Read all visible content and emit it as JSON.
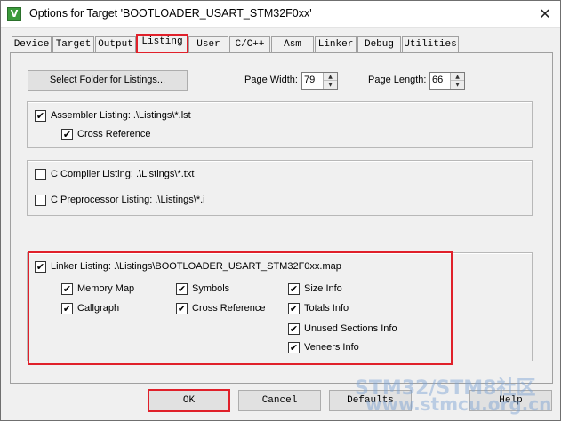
{
  "window": {
    "title": "Options for Target 'BOOTLOADER_USART_STM32F0xx'",
    "close_glyph": "✕",
    "app_icon_letter": "V"
  },
  "tabs": [
    {
      "label": "Device"
    },
    {
      "label": "Target"
    },
    {
      "label": "Output"
    },
    {
      "label": "Listing",
      "active": true
    },
    {
      "label": "User"
    },
    {
      "label": "C/C++"
    },
    {
      "label": "Asm"
    },
    {
      "label": "Linker"
    },
    {
      "label": "Debug"
    },
    {
      "label": "Utilities"
    }
  ],
  "top_row": {
    "select_folder_label": "Select Folder for Listings...",
    "page_width_label": "Page Width:",
    "page_width_value": "79",
    "page_length_label": "Page Length:",
    "page_length_value": "66"
  },
  "assembler": {
    "listing_label": "Assembler Listing:  .\\Listings\\*.lst",
    "listing_checked": true,
    "cross_ref_label": "Cross Reference",
    "cross_ref_checked": true
  },
  "compiler": {
    "c_compiler_label": "C Compiler Listing:  .\\Listings\\*.txt",
    "c_compiler_checked": false,
    "c_preprocessor_label": "C Preprocessor Listing:  .\\Listings\\*.i",
    "c_preprocessor_checked": false
  },
  "linker": {
    "listing_label": "Linker Listing:  .\\Listings\\BOOTLOADER_USART_STM32F0xx.map",
    "listing_checked": true,
    "options": [
      {
        "label": "Memory Map",
        "checked": true
      },
      {
        "label": "Symbols",
        "checked": true
      },
      {
        "label": "Size Info",
        "checked": true
      },
      {
        "label": "Callgraph",
        "checked": true
      },
      {
        "label": "Cross Reference",
        "checked": true
      },
      {
        "label": "Totals Info",
        "checked": true
      },
      {
        "label": "Unused Sections Info",
        "checked": true
      },
      {
        "label": "Veneers Info",
        "checked": true
      }
    ]
  },
  "footer": {
    "ok_label": "OK",
    "cancel_label": "Cancel",
    "defaults_label": "Defaults",
    "help_label": "Help"
  },
  "watermark": {
    "line1": "STM32/STM8社区",
    "line2": "www.stmcu.org.cn"
  },
  "colors": {
    "highlight_red": "#e0202a",
    "dialog_bg": "#f0f0f0"
  },
  "check_glyph": "✔"
}
